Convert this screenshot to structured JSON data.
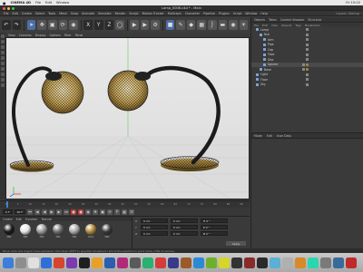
{
  "menubar": {
    "apple": "",
    "app_name": "CINEMA 4D",
    "items": [
      "File",
      "Edit",
      "Window"
    ],
    "right": [
      "Fri 15:02"
    ]
  },
  "window": {
    "title": "Lamp_0006.c4d * - Main"
  },
  "c4d_menu": [
    "File",
    "Edit",
    "Create",
    "Select",
    "Tools",
    "Mesh",
    "Snap",
    "Animate",
    "Simulate",
    "Render",
    "Sculpt",
    "Motion Tracker",
    "MoGraph",
    "Character",
    "Pipeline",
    "Plugins",
    "Script",
    "Window",
    "Help"
  ],
  "layout_label": "Layout: Startup",
  "viewport": {
    "menu": [
      "View",
      "Cameras",
      "Display",
      "Options",
      "Filter",
      "Panel"
    ],
    "label": "Perspective"
  },
  "object_manager": {
    "tabs": [
      "Objects",
      "Takes",
      "Content Browser",
      "Structure"
    ],
    "menu": [
      "File",
      "Edit",
      "View",
      "Objects",
      "Tags",
      "Bookmarks"
    ],
    "rows": [
      {
        "name": "Lamp",
        "indent": 0,
        "sel": false,
        "mat": false
      },
      {
        "name": "Null",
        "indent": 1,
        "sel": false,
        "mat": false
      },
      {
        "name": "Arm",
        "indent": 2,
        "sel": false,
        "mat": false
      },
      {
        "name": "Pipe",
        "indent": 2,
        "sel": false,
        "mat": false
      },
      {
        "name": "Cap",
        "indent": 2,
        "sel": false,
        "mat": false
      },
      {
        "name": "Tube",
        "indent": 2,
        "sel": false,
        "mat": false
      },
      {
        "name": "Disc",
        "indent": 2,
        "sel": false,
        "mat": false
      },
      {
        "name": "Sphere",
        "indent": 2,
        "sel": true,
        "mat": true
      },
      {
        "name": "Base",
        "indent": 1,
        "sel": false,
        "mat": true
      },
      {
        "name": "Light",
        "indent": 0,
        "sel": false,
        "mat": false
      },
      {
        "name": "Floor",
        "indent": 0,
        "sel": false,
        "mat": false
      },
      {
        "name": "Sky",
        "indent": 0,
        "sel": false,
        "mat": false
      }
    ]
  },
  "attribute_manager": {
    "tabs": [
      "Attributes",
      "Layers"
    ],
    "menu": [
      "Mode",
      "Edit",
      "User Data"
    ]
  },
  "timeline": {
    "ticks": [
      "0",
      "5",
      "10",
      "15",
      "20",
      "25",
      "30",
      "35",
      "40",
      "45",
      "50",
      "55",
      "60",
      "65",
      "70",
      "75",
      "80",
      "85",
      "90"
    ],
    "current": "0 F"
  },
  "transport": {
    "start": "0 F",
    "end": "90 F",
    "fields": [
      "0 F",
      "90 F"
    ]
  },
  "material_manager": {
    "menu": [
      "Create",
      "Edit",
      "Function",
      "Texture"
    ],
    "materials": [
      {
        "name": "Mat",
        "color": "#1a1a1a"
      },
      {
        "name": "Mat",
        "color": "#e6e6e6"
      },
      {
        "name": "Mat",
        "color": "#9a9a9a"
      },
      {
        "name": "Mat",
        "color": "#6f6f6f"
      },
      {
        "name": "Mat",
        "color": "#a8a8a8"
      },
      {
        "name": "Gold",
        "color": "#b08a3a"
      },
      {
        "name": "Mat",
        "color": "#3a3a3a"
      }
    ]
  },
  "coordinates": {
    "headers": [
      "Position",
      "Size",
      "Rotation"
    ],
    "rows": [
      {
        "axis": "X",
        "values": [
          "0 cm",
          "0 cm",
          "H 0 °"
        ]
      },
      {
        "axis": "Y",
        "values": [
          "0 cm",
          "0 cm",
          "P 0 °"
        ]
      },
      {
        "axis": "Z",
        "values": [
          "0 cm",
          "0 cm",
          "B 0 °"
        ]
      }
    ],
    "apply": "Apply"
  },
  "status_text": "Move: Click and drag to move elements. Hold down SHIFT to quantize movement / add to the selection in point mode, CTRL to remove.",
  "colors": {
    "accent": "#3d7edb",
    "gold": "#b08a3a",
    "record": "#b23a3a"
  },
  "dock": [
    "#3d7edb",
    "#8e8e8e",
    "#e0e0e0",
    "#2d6fd6",
    "#d6452d",
    "#7a3ab0",
    "#1f1f1f",
    "#e8a02a",
    "#2a5fb0",
    "#b02a7a",
    "#5a5a5a",
    "#2ab06f",
    "#d63a3a",
    "#3a3a8a",
    "#9a5a2a",
    "#2a8ad6",
    "#6fb02a",
    "#d6d62a",
    "#333333",
    "#8a2a2a",
    "#2a2a2a",
    "#5ab0d6",
    "#b0b0b0",
    "#d68a2a",
    "#2ad6b0",
    "#7a7a7a",
    "#3a6a9a",
    "#c02a2a"
  ]
}
